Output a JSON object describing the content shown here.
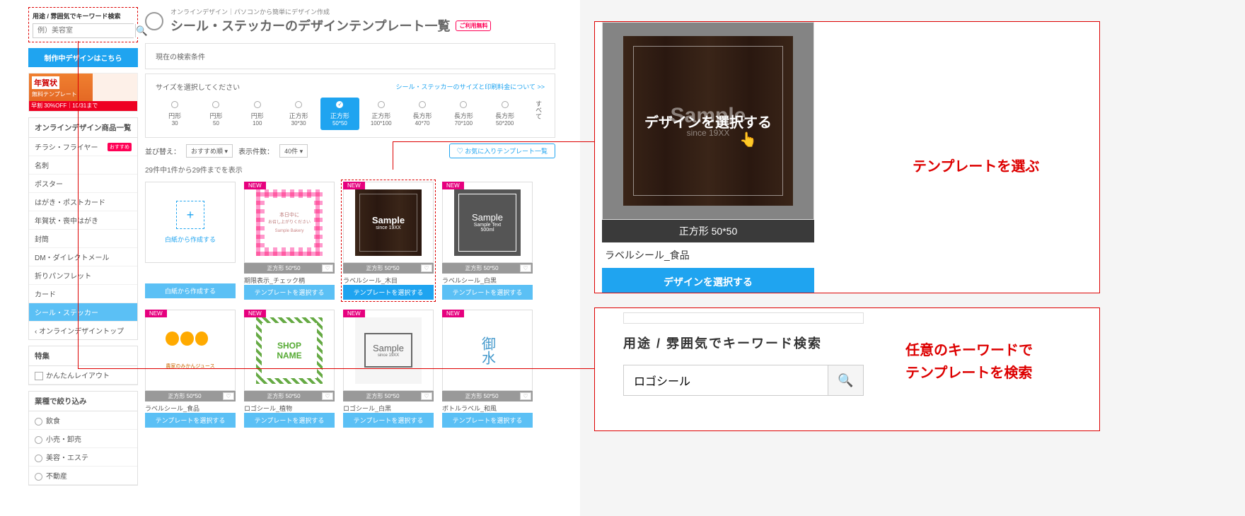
{
  "search": {
    "label": "用途 / 雰囲気でキーワード検索",
    "placeholder": "例）美容室"
  },
  "sidebar": {
    "in_progress": "制作中デザインはこちら",
    "banner": {
      "title": "年賀状",
      "sub": "無料テンプレート",
      "strip": "早割 30%OFF｜10/31まで"
    },
    "products_head": "オンラインデザイン商品一覧",
    "products": [
      {
        "label": "チラシ・フライヤー",
        "rec": "おすすめ"
      },
      {
        "label": "名刺"
      },
      {
        "label": "ポスター"
      },
      {
        "label": "はがき・ポストカード"
      },
      {
        "label": "年賀状・喪中はがき"
      },
      {
        "label": "封筒"
      },
      {
        "label": "DM・ダイレクトメール"
      },
      {
        "label": "折りパンフレット"
      },
      {
        "label": "カード"
      },
      {
        "label": "シール・ステッカー",
        "active": true
      }
    ],
    "back": "オンラインデザイントップ",
    "feature_head": "特集",
    "feature_item": "かんたんレイアウト",
    "industry_head": "業種で絞り込み",
    "industries": [
      "飲食",
      "小売・卸売",
      "美容・エステ",
      "不動産"
    ]
  },
  "header": {
    "sup": "オンラインデザイン｜パソコンから簡単にデザイン作成",
    "title": "シール・ステッカーのデザインテンプレート一覧",
    "free": "ご利用無料"
  },
  "filter": {
    "current": "現在の検索条件",
    "size_label": "サイズを選択してください",
    "size_link": "シール・ステッカーのサイズと印刷料金について >>",
    "sizes": [
      {
        "shape": "円形",
        "dim": "30"
      },
      {
        "shape": "円形",
        "dim": "50"
      },
      {
        "shape": "円形",
        "dim": "100"
      },
      {
        "shape": "正方形",
        "dim": "30*30"
      },
      {
        "shape": "正方形",
        "dim": "50*50",
        "sel": true
      },
      {
        "shape": "正方形",
        "dim": "100*100"
      },
      {
        "shape": "長方形",
        "dim": "40*70"
      },
      {
        "shape": "長方形",
        "dim": "70*100"
      },
      {
        "shape": "長方形",
        "dim": "50*200"
      }
    ],
    "all": "すべて"
  },
  "toolbar": {
    "sort_label": "並び替え：",
    "sort_value": "おすすめ順",
    "count_label": "表示件数：",
    "count_value": "40件",
    "fav": "♡ お気に入りテンプレート一覧"
  },
  "result_count": "29件中1件から29件までを表示",
  "cards": {
    "create_blank": "白紙から作成する",
    "create_btn": "白紙から作成する",
    "select_btn": "テンプレートを選択する",
    "size_text": "正方形 50*50",
    "row1": [
      {
        "name": "期限表示_チェック柄"
      },
      {
        "name": "ラベルシール_木目"
      },
      {
        "name": "ラベルシール_白黒"
      }
    ],
    "row2": [
      {
        "name": "ラベルシール_食品"
      },
      {
        "name": "ロゴシール_植物"
      },
      {
        "name": "ロゴシール_白黒"
      },
      {
        "name": "ボトルラベル_和風"
      }
    ]
  },
  "callout1": {
    "size_bar": "正方形 50*50",
    "hover_text": "デザインを選択する",
    "sample": "Sample",
    "since": "since 19XX",
    "left_name_suffix": "柄",
    "right_name": "ラベルシール_食品",
    "left_btn_suffix": "する",
    "right_btn": "デザインを選択する",
    "label": "テンプレートを選ぶ",
    "bakery_suffix": "さい",
    "bakery_suffix2": "ery"
  },
  "callout2": {
    "head": "用途 / 雰囲気でキーワード検索",
    "value": "ロゴシール",
    "label": "任意のキーワードで\nテンプレートを検索"
  }
}
